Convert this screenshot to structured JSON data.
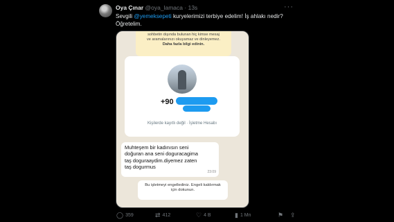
{
  "tweet": {
    "display_name": "Oya Çınar",
    "handle": "@oya_lamaca",
    "separator": "·",
    "time": "13s",
    "more_icon": "···",
    "text_prefix": "Sevgili ",
    "mention": "@yemeksepeti",
    "text_suffix": " kuryelerimizi terbiye edelim! İş ahlakı nedir? Öğretelim."
  },
  "screenshot": {
    "notice_lines": [
      "sohbetin dışında bulunan hiç kimse mesaj",
      "ve aramalarınızı okuyamaz ve dinleyemez."
    ],
    "notice_link": "Daha fazla bilgi edinin.",
    "phone_prefix": "+90",
    "contact_info": "Kişilerde kayıtlı değil · İşletme Hesabı",
    "message_lines": [
      "Muhteşem bir kadınısın seni",
      "doğuran ana seni doguracagima",
      "taş doguraaydim.diyemez zaten",
      "taş dogurmus"
    ],
    "message_time": "23:09",
    "system_lines": [
      "Bu işletmeyi engellediniz. Engeli kaldırmak",
      "için dokunun."
    ]
  },
  "actions": {
    "reply_icon": "◯",
    "reply_count": "359",
    "retweet_icon": "⇄",
    "retweet_count": "412",
    "like_icon": "♡",
    "like_count": "4 B",
    "views_icon": "▮",
    "views_count": "1 Mn",
    "bookmark_icon": "⚑",
    "share_icon": "⇪"
  }
}
